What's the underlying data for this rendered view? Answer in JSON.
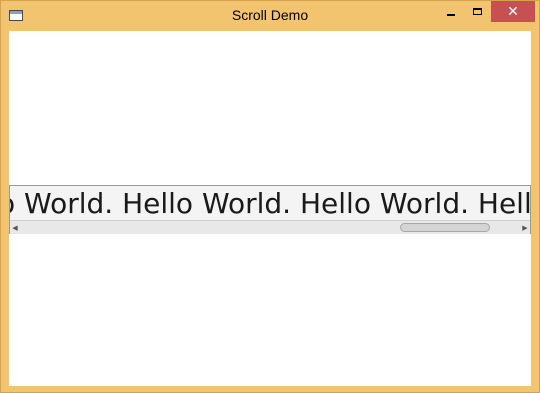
{
  "window": {
    "title": "Scroll Demo",
    "close_glyph": "✕",
    "icons": {
      "app": "window-app-icon",
      "minimize": "minimize-icon",
      "maximize": "maximize-icon",
      "close": "close-icon"
    },
    "accent_color": "#f2c46f",
    "close_color": "#c75050"
  },
  "content": {
    "scroll_text": "o World. Hello World. Hello World. Hello World.",
    "horizontal_scroll_position": 0.78
  },
  "scrollbar": {
    "left_arrow": "◀",
    "right_arrow": "▶"
  }
}
